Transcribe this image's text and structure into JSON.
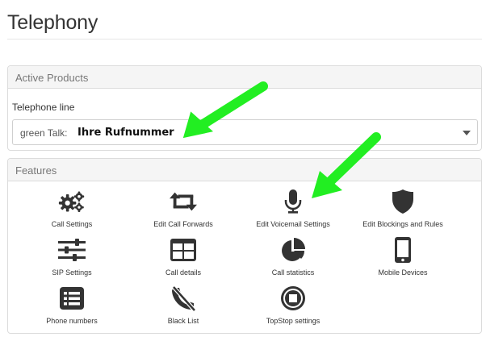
{
  "page": {
    "title": "Telephony"
  },
  "active_products": {
    "heading": "Active Products",
    "telephone_line_label": "Telephone line",
    "select_prefix": "green Talk:",
    "select_value": "Ihre Rufnummer"
  },
  "features": {
    "heading": "Features",
    "items": [
      {
        "label": "Call Settings",
        "icon": "gears-icon"
      },
      {
        "label": "Edit Call Forwards",
        "icon": "retweet-icon"
      },
      {
        "label": "Edit Voicemail Settings",
        "icon": "microphone-icon"
      },
      {
        "label": "Edit Blockings and Rules",
        "icon": "shield-icon"
      },
      {
        "label": "SIP Settings",
        "icon": "sliders-icon"
      },
      {
        "label": "Call details",
        "icon": "table-icon"
      },
      {
        "label": "Call statistics",
        "icon": "pie-chart-icon"
      },
      {
        "label": "Mobile Devices",
        "icon": "mobile-icon"
      },
      {
        "label": "Phone numbers",
        "icon": "list-icon"
      },
      {
        "label": "Black List",
        "icon": "phone-slash-icon"
      },
      {
        "label": "TopStop settings",
        "icon": "stop-circle-icon"
      }
    ]
  },
  "colors": {
    "icon": "#333333",
    "arrow": "#22ee22",
    "border": "#dcdcdc",
    "heading_bg": "#f5f5f5"
  }
}
